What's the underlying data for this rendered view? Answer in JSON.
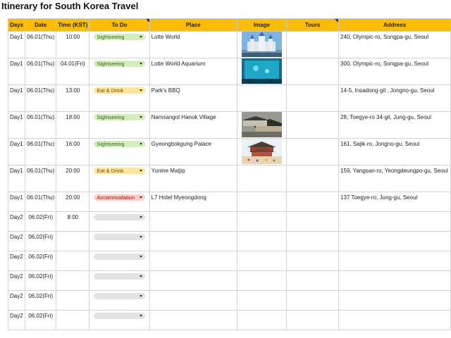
{
  "title": "Itinerary for South Korea Travel",
  "columns": [
    "Days",
    "Date",
    "Time (KST)",
    "To Do",
    "Place",
    "Image",
    "Tours",
    "Address"
  ],
  "colors": {
    "header": "#fbbc04",
    "sightseeing_bg": "#d4edbc",
    "sightseeing_fg": "#2d6a1e",
    "eat_bg": "#ffe5a0",
    "eat_fg": "#6b4a00",
    "accommodation_bg": "#ffcfc9",
    "accommodation_fg": "#b10202",
    "empty_chip": "#e1e3e5"
  },
  "rows": [
    {
      "day": "Day1",
      "date": "06.01(Thu)",
      "time": "10:00",
      "todo": "Sightseeing",
      "todo_style": "sightseeing",
      "place": "Lotte World",
      "image": "castle-image",
      "tours": "",
      "address": "240, Olympic-ro, Songpa-gu, Seoul"
    },
    {
      "day": "Day1",
      "date": "06.01(Thu)",
      "time": "04.01(Fri)",
      "todo": "Sightseeing",
      "todo_style": "sightseeing",
      "place": "Lotte World Aquarium",
      "image": "aquarium-image",
      "tours": "",
      "address": "300, Olympic-ro, Songpa-gu, Seoul"
    },
    {
      "day": "Day1",
      "date": "06.01(Thu)",
      "time": "13:00",
      "todo": "Eat & Drink",
      "todo_style": "eat",
      "place": "Park's BBQ",
      "image": "",
      "tours": "",
      "address": "14-5, Insadong-gil , Jongno-gu, Seoul"
    },
    {
      "day": "Day1",
      "date": "06.01(Thu)",
      "time": "18:00",
      "todo": "Sightseeing",
      "todo_style": "sightseeing",
      "place": "Namsangol Hanok Village",
      "image": "hanok-image",
      "tours": "",
      "address": "28, Toegye-ro 34-gil, Jung-gu, Seoul"
    },
    {
      "day": "Day1",
      "date": "06.01(Thu)",
      "time": "16:00",
      "todo": "Sightseeing",
      "todo_style": "sightseeing",
      "place": "Gyeongbokgung Palace",
      "image": "palace-image",
      "tours": "",
      "address": "161, Sajik-ro, Jongno-gu, Seoul"
    },
    {
      "day": "Day1",
      "date": "06.01(Thu)",
      "time": "20:00",
      "todo": "Eat & Drink",
      "todo_style": "eat",
      "place": "Yunine Matjip",
      "image": "",
      "tours": "",
      "address": "159, Yangsan-ro, Yeongdeungpo-gu, Seoul"
    },
    {
      "day": "Day1",
      "date": "06.01(Thu)",
      "time": "20:00",
      "todo": "Accommodation",
      "todo_style": "accommodation",
      "place": "L7 Hotel Myeongdong",
      "image": "",
      "tours": "",
      "address": "137 Toegye-ro, Jung-gu, Seoul"
    },
    {
      "day": "Day2",
      "date": "06.02(Fri)",
      "time": "8:00",
      "todo": "",
      "todo_style": "empty",
      "place": "",
      "image": "",
      "tours": "",
      "address": ""
    },
    {
      "day": "Day2",
      "date": "06.02(Fri)",
      "time": "",
      "todo": "",
      "todo_style": "empty",
      "place": "",
      "image": "",
      "tours": "",
      "address": ""
    },
    {
      "day": "Day2",
      "date": "06.02(Fri)",
      "time": "",
      "todo": "",
      "todo_style": "empty",
      "place": "",
      "image": "",
      "tours": "",
      "address": ""
    },
    {
      "day": "Day2",
      "date": "06.02(Fri)",
      "time": "",
      "todo": "",
      "todo_style": "empty",
      "place": "",
      "image": "",
      "tours": "",
      "address": ""
    },
    {
      "day": "Day2",
      "date": "06.02(Fri)",
      "time": "",
      "todo": "",
      "todo_style": "empty",
      "place": "",
      "image": "",
      "tours": "",
      "address": ""
    },
    {
      "day": "Day2",
      "date": "06.02(Fri)",
      "time": "",
      "todo": "",
      "todo_style": "empty",
      "place": "",
      "image": "",
      "tours": "",
      "address": ""
    }
  ]
}
